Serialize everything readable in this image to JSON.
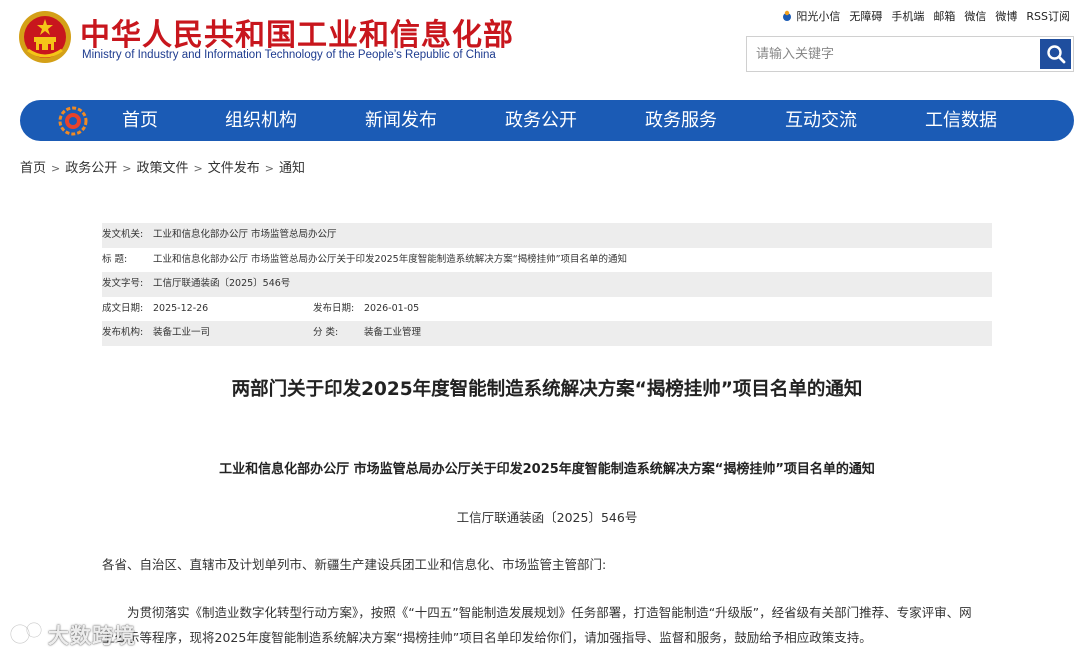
{
  "header": {
    "title": "中华人民共和国工业和信息化部",
    "subtitle": "Ministry of Industry and Information Technology of the People’s Republic of China"
  },
  "toplinks": [
    "阳光小信",
    "无障碍",
    "手机端",
    "邮箱",
    "微信",
    "微博",
    "RSS订阅"
  ],
  "search": {
    "placeholder": "请输入关键字"
  },
  "nav": [
    "首页",
    "组织机构",
    "新闻发布",
    "政务公开",
    "政务服务",
    "互动交流",
    "工信数据"
  ],
  "breadcrumb": [
    "首页",
    "政务公开",
    "政策文件",
    "文件发布",
    "通知"
  ],
  "info": {
    "issuer_label": "发文机关:",
    "issuer": "工业和信息化部办公厅 市场监管总局办公厅",
    "subject_label": "标      题:",
    "subject": "工业和信息化部办公厅 市场监管总局办公厅关于印发2025年度智能制造系统解决方案“揭榜挂帅”项目名单的通知",
    "docno_label": "发文字号:",
    "docno": "工信厅联通装函〔2025〕546号",
    "created_label": "成文日期:",
    "created": "2025-12-26",
    "published_label": "发布日期:",
    "published": "2026-01-05",
    "org_label": "发布机构:",
    "org": "装备工业一司",
    "category_label": "分      类:",
    "category": "装备工业管理"
  },
  "article": {
    "title": "两部门关于印发2025年度智能制造系统解决方案“揭榜挂帅”项目名单的通知",
    "subtitle": "工业和信息化部办公厅  市场监管总局办公厅关于印发2025年度智能制造系统解决方案“揭榜挂帅”项目名单的通知",
    "doc_no": "工信厅联通装函〔2025〕546号",
    "recipients": "各省、自治区、直辖市及计划单列市、新疆生产建设兵团工业和信息化、市场监管主管部门:",
    "paragraph": "为贯彻落实《制造业数字化转型行动方案》，按照《“十四五”智能制造发展规划》任务部署，打造智能制造“升级版”，经省级有关部门推荐、专家评审、网上公示等程序，现将2025年度智能制造系统解决方案“揭榜挂帅”项目名单印发给你们，请加强指导、监督和服务，鼓励给予相应政策支持。"
  },
  "watermark": "大数跨境",
  "colors": {
    "brand_red": "#c8161d",
    "nav_blue": "#1b5bb5",
    "search_blue": "#1f4e9e",
    "info_shade": "#ededed"
  }
}
